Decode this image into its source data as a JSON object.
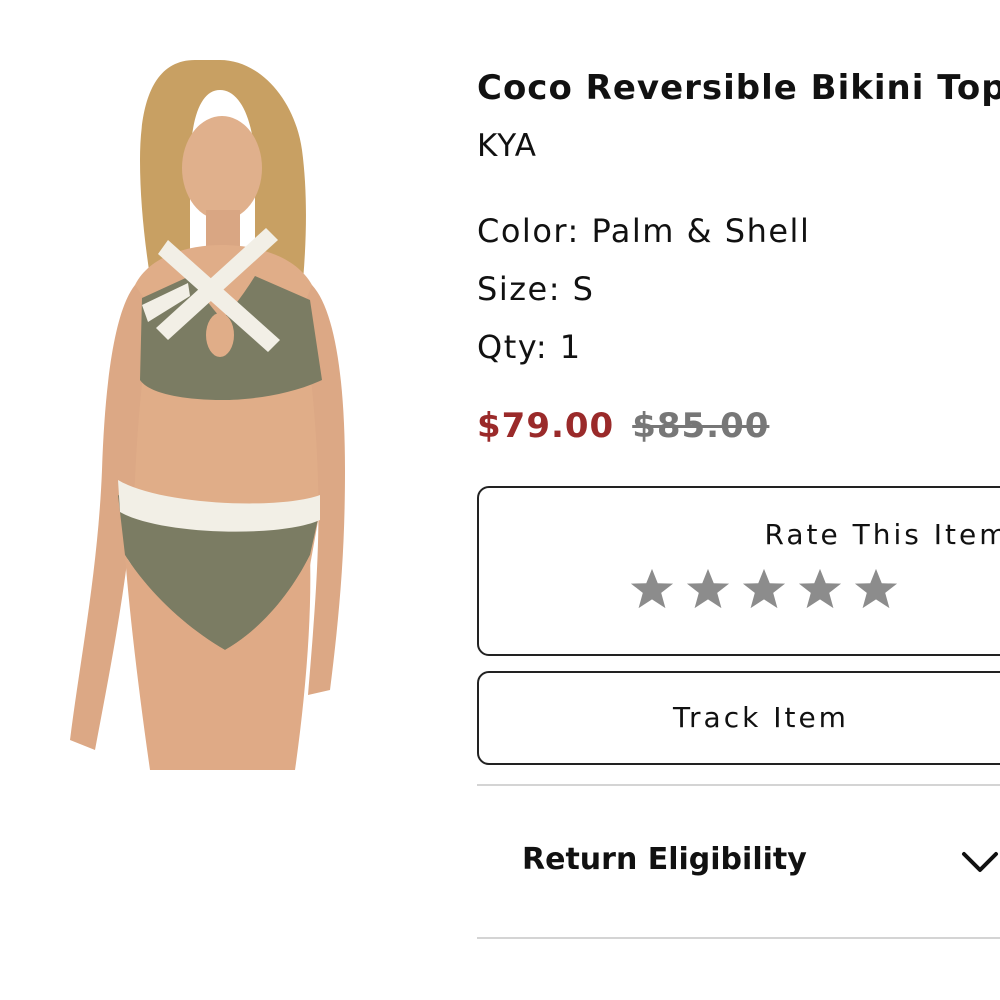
{
  "product": {
    "title": "Coco Reversible Bikini Top",
    "brand": "KYA",
    "color_label": "Color: Palm & Shell",
    "size_label": "Size: S",
    "qty_label": "Qty: 1",
    "price_sale": "$79.00",
    "price_original": "$85.00"
  },
  "rating": {
    "label": "Rate This Item",
    "stars_total": 5,
    "stars_selected": 0,
    "star_icon": "star-icon",
    "star_color": "#8c8c8c"
  },
  "track": {
    "label": "Track Item"
  },
  "return_section": {
    "label": "Return Eligibility",
    "icon": "chevron-down-icon"
  },
  "colors": {
    "sale_price": "#9a2a2a",
    "original_price": "#777777",
    "garment_olive": "#7b7c63",
    "garment_trim": "#f2efe6"
  }
}
